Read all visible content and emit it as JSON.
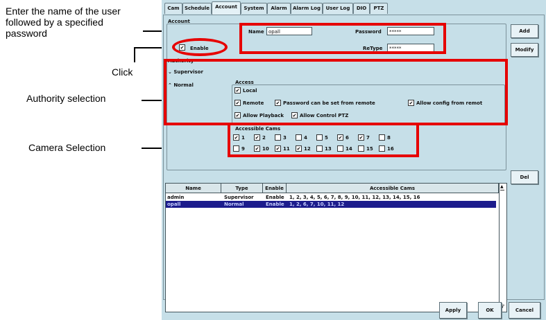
{
  "annotations": {
    "name_instruction": "Enter the name of the user followed by a specified password",
    "click": "Click",
    "authority_selection": "Authority selection",
    "camera_selection": "Camera Selection"
  },
  "tabs": [
    "Cam",
    "Schedule",
    "Account",
    "System",
    "Alarm",
    "Alarm Log",
    "User Log",
    "DIO",
    "PTZ"
  ],
  "active_tab": "Account",
  "account": {
    "group_label": "Account",
    "name_label": "Name",
    "name_value": "opall",
    "password_label": "Password",
    "password_value": "*****",
    "retype_label": "ReType",
    "retype_value": "*****",
    "enable_label": "Enable",
    "enable_checked": true
  },
  "authority": {
    "label": "Authority",
    "supervisor": "Supervisor",
    "normal": "Normal",
    "selected": "Normal"
  },
  "access": {
    "label": "Access",
    "local": "Local",
    "remote": "Remote",
    "password_remote": "Password can be set from remote",
    "config_remote": "Allow config from remot",
    "playback": "Allow Playback",
    "control_ptz": "Allow Control PTZ"
  },
  "accessible_cams": {
    "label": "Accessible Cams",
    "cams": [
      {
        "n": "1",
        "on": true
      },
      {
        "n": "2",
        "on": true
      },
      {
        "n": "3",
        "on": false
      },
      {
        "n": "4",
        "on": false
      },
      {
        "n": "5",
        "on": false
      },
      {
        "n": "6",
        "on": true
      },
      {
        "n": "7",
        "on": true
      },
      {
        "n": "8",
        "on": false
      },
      {
        "n": "9",
        "on": false
      },
      {
        "n": "10",
        "on": true
      },
      {
        "n": "11",
        "on": true
      },
      {
        "n": "12",
        "on": true
      },
      {
        "n": "13",
        "on": false
      },
      {
        "n": "14",
        "on": false
      },
      {
        "n": "15",
        "on": false
      },
      {
        "n": "16",
        "on": false
      }
    ]
  },
  "buttons": {
    "add": "Add",
    "modify": "Modify",
    "del": "Del",
    "apply": "Apply",
    "ok": "OK",
    "cancel": "Cancel"
  },
  "table": {
    "headers": [
      "Name",
      "Type",
      "Enable",
      "Accessible Cams"
    ],
    "rows": [
      {
        "name": "admin",
        "type": "Supervisor",
        "enable": "Enable",
        "cams": "1, 2, 3, 4, 5, 6, 7, 8, 9, 10, 11, 12, 13, 14, 15, 16",
        "selected": false
      },
      {
        "name": "opall",
        "type": "Normal",
        "enable": "Enable",
        "cams": "1, 2, 6, 7, 10, 11, 12",
        "selected": true
      }
    ]
  },
  "colors": {
    "highlight": "#e60000",
    "selection": "#1c1c8c",
    "window_bg": "#c6dfe8"
  }
}
